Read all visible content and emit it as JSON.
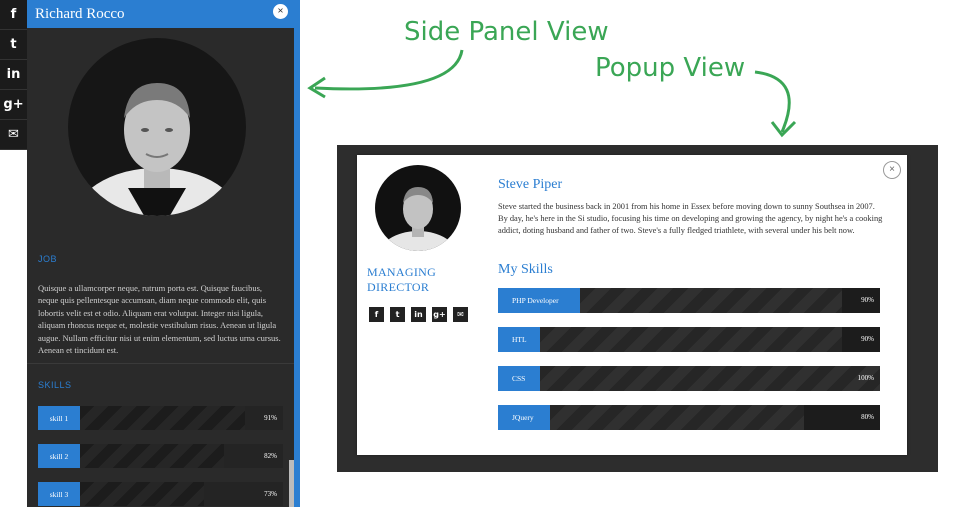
{
  "social_bar": {
    "items": [
      {
        "icon": "facebook-icon",
        "glyph": "f"
      },
      {
        "icon": "twitter-icon",
        "glyph": "t"
      },
      {
        "icon": "linkedin-icon",
        "glyph": "in"
      },
      {
        "icon": "google-plus-icon",
        "glyph": "g+"
      },
      {
        "icon": "mail-icon",
        "glyph": "✉"
      }
    ]
  },
  "side_panel": {
    "name": "Richard Rocco",
    "close_glyph": "×",
    "job_title": "JOB",
    "job_text": "Quisque a ullamcorper neque, rutrum porta est. Quisque faucibus, neque quis pellentesque accumsan, diam neque commodo elit, quis lobortis velit est et odio. Aliquam erat volutpat. Integer nisi ligula, aliquam rhoncus neque et, molestie vestibulum risus. Aenean ut ligula augue. Nullam efficitur nisi ut enim elementum, sed luctus urna cursus. Aenean et tincidunt est.",
    "skills_title": "SKILLS",
    "skills": [
      {
        "label": "skill 1",
        "pct_text": "91%",
        "value": 0.91
      },
      {
        "label": "skill 2",
        "pct_text": "82%",
        "value": 0.82
      },
      {
        "label": "skill 3",
        "pct_text": "73%",
        "value": 0.73
      }
    ]
  },
  "annotations": {
    "side_panel_label": "Side Panel View",
    "popup_label": "Popup View",
    "color": "#3aa655"
  },
  "popup": {
    "close_glyph": "×",
    "name": "Steve Piper",
    "role_line1": "MANAGING",
    "role_line2": "DIRECTOR",
    "bio": "Steve started the business back in 2001 from his home in Essex before moving down to sunny Southsea in 2007. By day, he's here in the Si studio, focusing his time on developing and growing the agency, by night he's a cooking addict, doting husband and father of two. Steve's a fully fledged triathlete, with several under his belt now.",
    "skills_title": "My Skills",
    "social": [
      {
        "icon": "facebook-icon",
        "glyph": "f"
      },
      {
        "icon": "twitter-icon",
        "glyph": "t"
      },
      {
        "icon": "linkedin-icon",
        "glyph": "in"
      },
      {
        "icon": "google-plus-icon",
        "glyph": "g+"
      },
      {
        "icon": "mail-icon",
        "glyph": "✉"
      }
    ],
    "skills": [
      {
        "label": "PHP Developer",
        "pct_text": "90%",
        "value": 0.9
      },
      {
        "label": "HTL",
        "pct_text": "90%",
        "value": 0.9
      },
      {
        "label": "CSS",
        "pct_text": "100%",
        "value": 1.0
      },
      {
        "label": "JQuery",
        "pct_text": "80%",
        "value": 0.8
      }
    ]
  },
  "colors": {
    "accent": "#2b7ed1",
    "panel_bg": "#2a2a2a",
    "annotation": "#3aa655"
  }
}
